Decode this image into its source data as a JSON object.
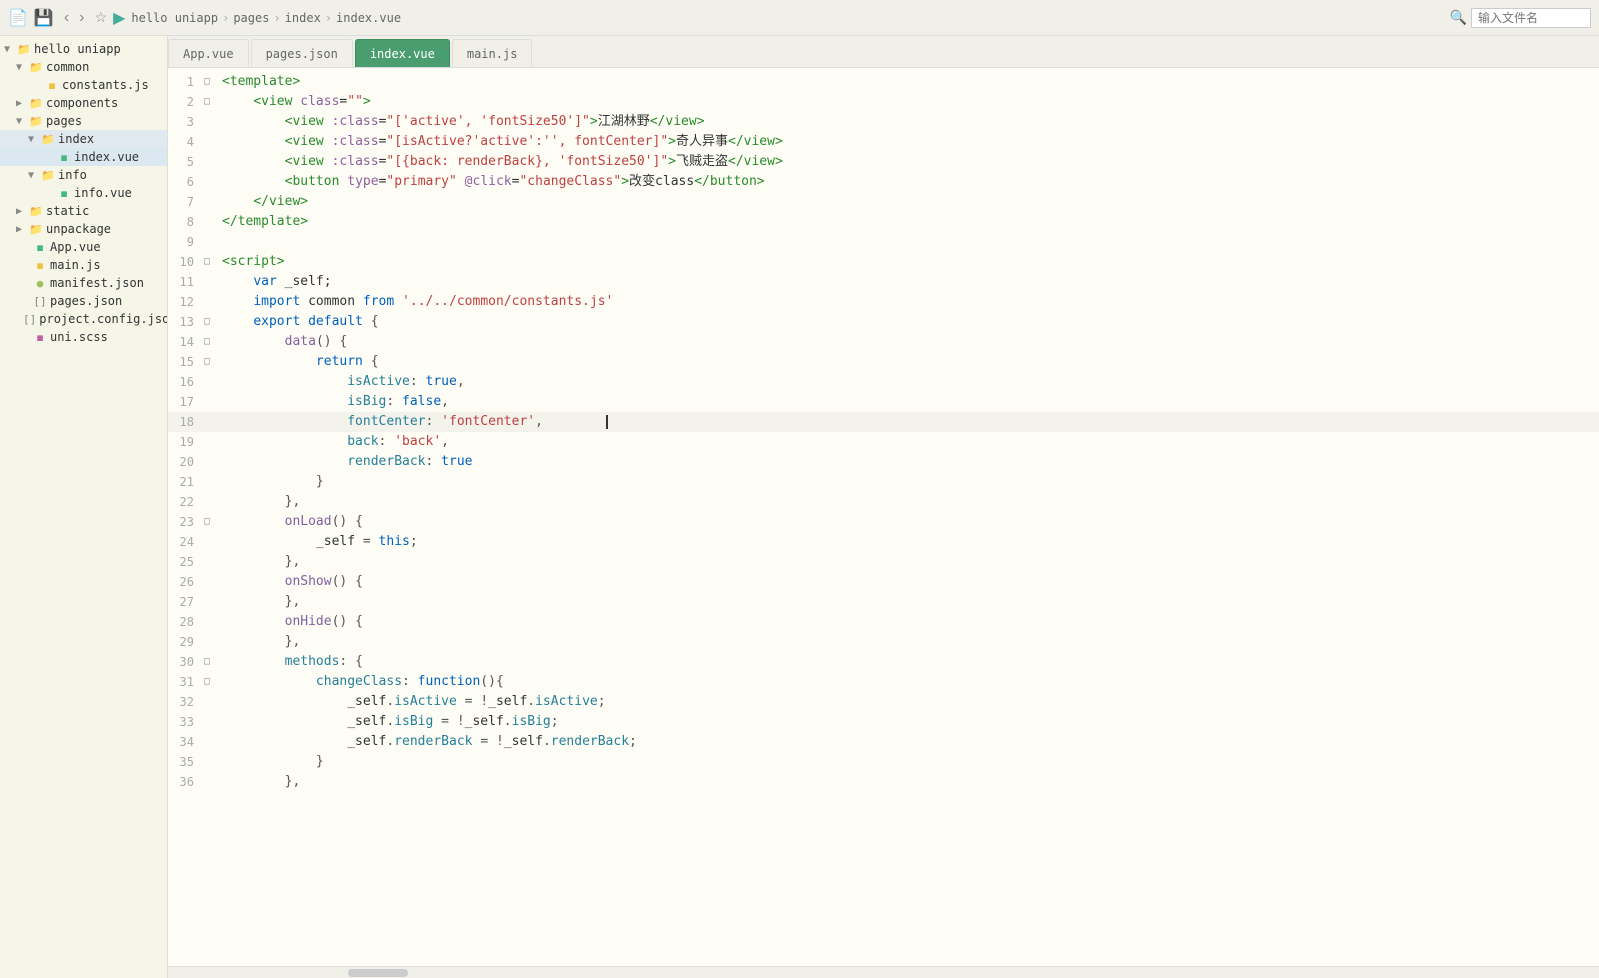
{
  "topbar": {
    "file_icon": "📄",
    "nav_back": "‹",
    "nav_forward": "›",
    "star": "☆",
    "run": "▶",
    "breadcrumb": [
      "hello uniapp",
      "pages",
      "index",
      "index.vue"
    ],
    "search_icon": "🔍",
    "search_placeholder": "输入文件名"
  },
  "tabs": [
    {
      "label": "App.vue",
      "active": false,
      "type": "vue"
    },
    {
      "label": "pages.json",
      "active": false,
      "type": "json"
    },
    {
      "label": "index.vue",
      "active": true,
      "type": "vue"
    },
    {
      "label": "main.js",
      "active": false,
      "type": "js"
    }
  ],
  "sidebar": {
    "title": "hello uniapp",
    "items": [
      {
        "level": 0,
        "type": "folder",
        "label": "hello uniapp",
        "expanded": true,
        "id": "root"
      },
      {
        "level": 1,
        "type": "folder",
        "label": "common",
        "expanded": true,
        "id": "common"
      },
      {
        "level": 2,
        "type": "js",
        "label": "constants.js",
        "id": "constants"
      },
      {
        "level": 1,
        "type": "folder",
        "label": "components",
        "expanded": false,
        "id": "components"
      },
      {
        "level": 1,
        "type": "folder",
        "label": "pages",
        "expanded": true,
        "id": "pages"
      },
      {
        "level": 2,
        "type": "folder",
        "label": "index",
        "expanded": true,
        "id": "index-folder",
        "active": true
      },
      {
        "level": 3,
        "type": "vue",
        "label": "index.vue",
        "id": "index-vue",
        "active": true
      },
      {
        "level": 2,
        "type": "folder",
        "label": "info",
        "expanded": true,
        "id": "info-folder"
      },
      {
        "level": 3,
        "type": "vue",
        "label": "info.vue",
        "id": "info-vue"
      },
      {
        "level": 1,
        "type": "folder",
        "label": "static",
        "expanded": false,
        "id": "static"
      },
      {
        "level": 1,
        "type": "folder",
        "label": "unpackage",
        "expanded": false,
        "id": "unpackage"
      },
      {
        "level": 1,
        "type": "vue",
        "label": "App.vue",
        "id": "app-vue"
      },
      {
        "level": 1,
        "type": "js",
        "label": "main.js",
        "id": "main-js"
      },
      {
        "level": 1,
        "type": "json",
        "label": "manifest.json",
        "id": "manifest"
      },
      {
        "level": 1,
        "type": "json2",
        "label": "pages.json",
        "id": "pages-json"
      },
      {
        "level": 1,
        "type": "json3",
        "label": "project.config.json",
        "id": "project-config"
      },
      {
        "level": 1,
        "type": "scss",
        "label": "uni.scss",
        "id": "uni-scss"
      }
    ]
  },
  "code": {
    "lines": [
      {
        "num": 1,
        "fold": "□",
        "content": "<template>"
      },
      {
        "num": 2,
        "fold": "□",
        "content": "    <view class=\"\">"
      },
      {
        "num": 3,
        "fold": "",
        "content": "        <view :class=\"['active', 'fontSize50']\">江湖林野</view>"
      },
      {
        "num": 4,
        "fold": "",
        "content": "        <view :class=\"[isActive?'active':'', fontCenter]\">奇人异事</view>"
      },
      {
        "num": 5,
        "fold": "",
        "content": "        <view :class=\"[{back: renderBack}, 'fontSize50']\">飞贼走盗</view>"
      },
      {
        "num": 6,
        "fold": "",
        "content": "        <button type=\"primary\" @click=\"changeClass\">改变class</button>"
      },
      {
        "num": 7,
        "fold": "",
        "content": "    </view>"
      },
      {
        "num": 8,
        "fold": "",
        "content": "</template>"
      },
      {
        "num": 9,
        "fold": "",
        "content": ""
      },
      {
        "num": 10,
        "fold": "□",
        "content": "<script>"
      },
      {
        "num": 11,
        "fold": "",
        "content": "    var _self;"
      },
      {
        "num": 12,
        "fold": "",
        "content": "    import common from '../../common/constants.js'"
      },
      {
        "num": 13,
        "fold": "□",
        "content": "    export default {"
      },
      {
        "num": 14,
        "fold": "□",
        "content": "        data() {"
      },
      {
        "num": 15,
        "fold": "□",
        "content": "            return {"
      },
      {
        "num": 16,
        "fold": "",
        "content": "                isActive: true,"
      },
      {
        "num": 17,
        "fold": "",
        "content": "                isBig: false,"
      },
      {
        "num": 18,
        "fold": "",
        "content": "                fontCenter: 'fontCenter',        |"
      },
      {
        "num": 19,
        "fold": "",
        "content": "                back: 'back',"
      },
      {
        "num": 20,
        "fold": "",
        "content": "                renderBack: true"
      },
      {
        "num": 21,
        "fold": "",
        "content": "            }"
      },
      {
        "num": 22,
        "fold": "",
        "content": "        },"
      },
      {
        "num": 23,
        "fold": "□",
        "content": "        onLoad() {"
      },
      {
        "num": 24,
        "fold": "",
        "content": "            _self = this;"
      },
      {
        "num": 25,
        "fold": "",
        "content": "        },"
      },
      {
        "num": 26,
        "fold": "",
        "content": "        onShow() {"
      },
      {
        "num": 27,
        "fold": "",
        "content": "        },"
      },
      {
        "num": 28,
        "fold": "",
        "content": "        onHide() {"
      },
      {
        "num": 29,
        "fold": "",
        "content": "        },"
      },
      {
        "num": 30,
        "fold": "□",
        "content": "        methods: {"
      },
      {
        "num": 31,
        "fold": "□",
        "content": "            changeClass: function(){"
      },
      {
        "num": 32,
        "fold": "",
        "content": "                _self.isActive = !_self.isActive;"
      },
      {
        "num": 33,
        "fold": "",
        "content": "                _self.isBig = !_self.isBig;"
      },
      {
        "num": 34,
        "fold": "",
        "content": "                _self.renderBack = !_self.renderBack;"
      },
      {
        "num": 35,
        "fold": "",
        "content": "            }"
      },
      {
        "num": 36,
        "fold": "",
        "content": "        },"
      }
    ]
  }
}
